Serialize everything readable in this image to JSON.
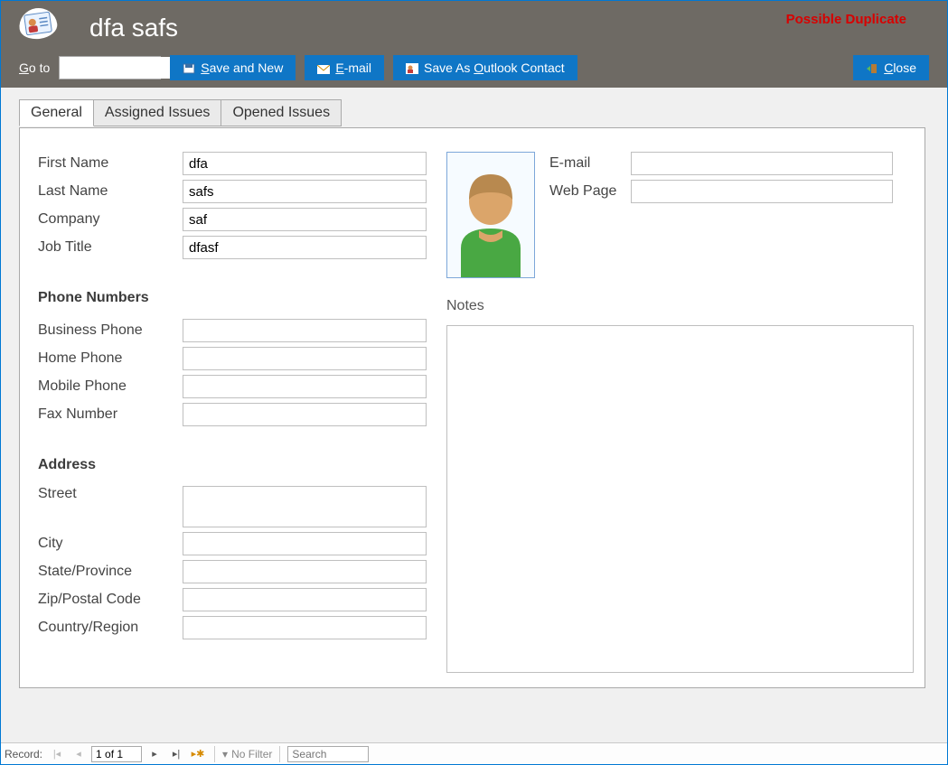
{
  "header": {
    "title": "dfa safs",
    "warning": "Possible Duplicate",
    "goto_label_pre": "G",
    "goto_label_post": "o to",
    "combo_value": "",
    "save_new": "ave and New",
    "save_new_u": "S",
    "email_u": "E",
    "email": "-mail",
    "outlook_pre": "Save As ",
    "outlook_u": "O",
    "outlook_post": "utlook Contact",
    "close_u": "C",
    "close": "lose"
  },
  "tabs": {
    "general": "General",
    "assigned": "Assigned Issues",
    "opened": "Opened Issues"
  },
  "labels": {
    "first_name": "First Name",
    "last_name": "Last Name",
    "company": "Company",
    "job_title": "Job Title",
    "phone_section": "Phone Numbers",
    "business_phone": "Business Phone",
    "home_phone": "Home Phone",
    "mobile_phone": "Mobile Phone",
    "fax": "Fax Number",
    "address_section": "Address",
    "street": "Street",
    "city": "City",
    "state": "State/Province",
    "zip": "Zip/Postal Code",
    "country": "Country/Region",
    "email": "E-mail",
    "webpage": "Web Page",
    "notes": "Notes"
  },
  "values": {
    "first_name": "dfa",
    "last_name": "safs",
    "company": "saf",
    "job_title": "dfasf",
    "business_phone": "",
    "home_phone": "",
    "mobile_phone": "",
    "fax": "",
    "street": "",
    "city": "",
    "state": "",
    "zip": "",
    "country": "",
    "email": "",
    "webpage": "",
    "notes": ""
  },
  "recnav": {
    "label": "Record:",
    "current": "1 of 1",
    "no_filter": "No Filter",
    "search_placeholder": "Search"
  }
}
